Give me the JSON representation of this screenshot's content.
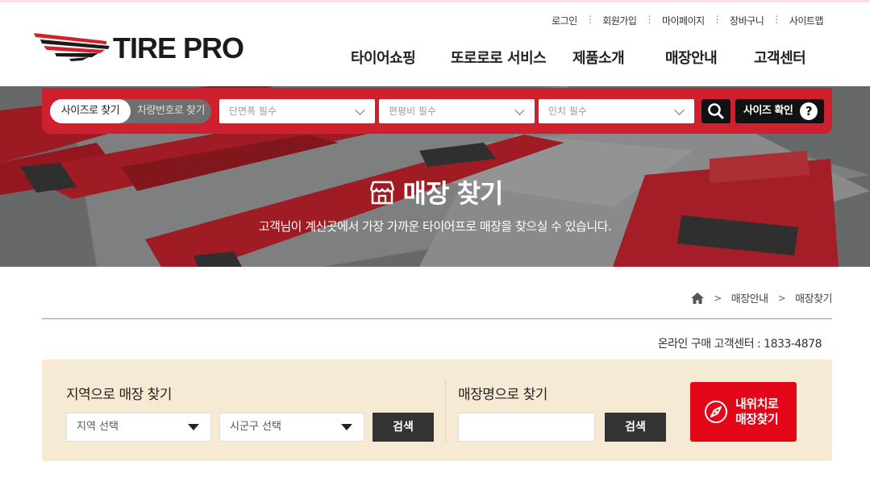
{
  "header": {
    "logo_text": "TIRE PRO",
    "util_links": [
      "로그인",
      "회원가입",
      "마이페이지",
      "장바구니",
      "사이트맵"
    ],
    "nav": [
      "타이어쇼핑",
      "또로로로 서비스",
      "제품소개",
      "매장안내",
      "고객센터"
    ]
  },
  "size_search": {
    "tab_active": "사이즈로 찾기",
    "tab_inactive": "차량번호로 찾기",
    "width_placeholder": "단면폭 필수",
    "ratio_placeholder": "편평비 필수",
    "inch_placeholder": "인치 필수",
    "confirm_label": "사이즈 확인",
    "help_glyph": "?"
  },
  "hero": {
    "title": "매장 찾기",
    "subtitle": "고객님이 계신곳에서 가장 가까운 타이어프로 매장을 찾으실 수 있습니다."
  },
  "breadcrumb": [
    "매장안내",
    "매장찾기"
  ],
  "phone": "온라인 구매 고객센터 : 1833-4878",
  "store_search": {
    "region_title": "지역으로 매장 찾기",
    "region_select": "지역 선택",
    "district_select": "시군구 선택",
    "search_label": "검색",
    "name_title": "매장명으로 찾기",
    "name_value": "",
    "name_search_label": "검색",
    "nearby_line1": "내위치로",
    "nearby_line2": "매장찾기"
  },
  "colors": {
    "brand_red": "#cf2030",
    "button_red": "#e30618",
    "panel_bg": "#f6ead5"
  }
}
